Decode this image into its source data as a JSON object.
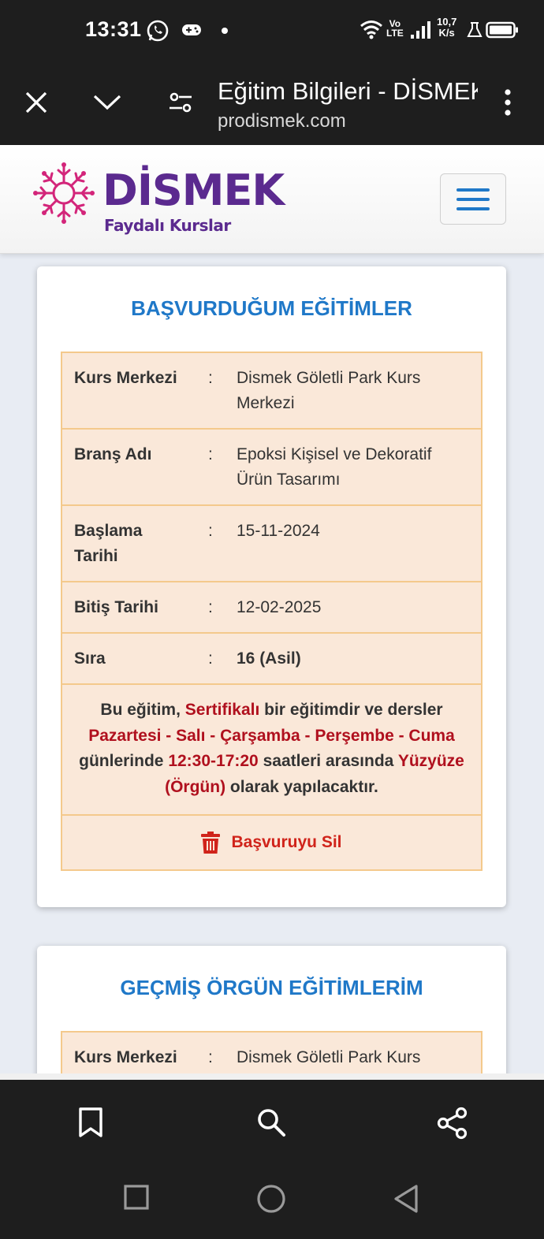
{
  "status_bar": {
    "time": "13:31",
    "network_top": "Vo",
    "network_bottom": "LTE",
    "speed_top": "10,7",
    "speed_bottom": "K/s"
  },
  "browser": {
    "page_title": "Eğitim Bilgileri - DİSMEK",
    "url": "prodismek.com"
  },
  "header": {
    "logo_name": "DİSMEK",
    "logo_tagline": "Faydalı Kurslar",
    "brand_color": "#5b2a8f",
    "flower_color": "#d3257a"
  },
  "applied_trainings": {
    "title": "BAŞVURDUĞUM EĞİTİMLER",
    "rows": [
      {
        "label": "Kurs Merkezi",
        "value": "Dismek Göletli Park Kurs Merkezi"
      },
      {
        "label": "Branş Adı",
        "value": "Epoksi Kişisel ve Dekoratif Ürün Tasarımı"
      },
      {
        "label": "Başlama Tarihi",
        "value": "15-11-2024"
      },
      {
        "label": "Bitiş Tarihi",
        "value": "12-02-2025"
      },
      {
        "label": "Sıra",
        "value": "16 (Asil)"
      }
    ],
    "colon": ":",
    "notice": {
      "t1": "Bu eğitim, ",
      "h1": "Sertifikalı",
      "t2": " bir eğitimdir ve dersler ",
      "h2": "Pazartesi - Salı - Çarşamba - Perşembe - Cuma",
      "t3": " günlerinde ",
      "h3": "12:30-17:20",
      "t4": " saatleri arasında ",
      "h4": "Yüzyüze (Örgün)",
      "t5": " olarak yapılacaktır."
    },
    "delete_label": "Başvuruyu Sil"
  },
  "past_trainings": {
    "title": "GEÇMİŞ ÖRGÜN EĞİTİMLERİM",
    "rows": [
      {
        "label": "Kurs Merkezi",
        "value": "Dismek Göletli Park Kurs"
      }
    ]
  },
  "colors": {
    "accent_blue": "#1f78c8",
    "highlight_red": "#b0101e",
    "table_bg": "#fae8d9",
    "table_border": "#f4c98c"
  }
}
